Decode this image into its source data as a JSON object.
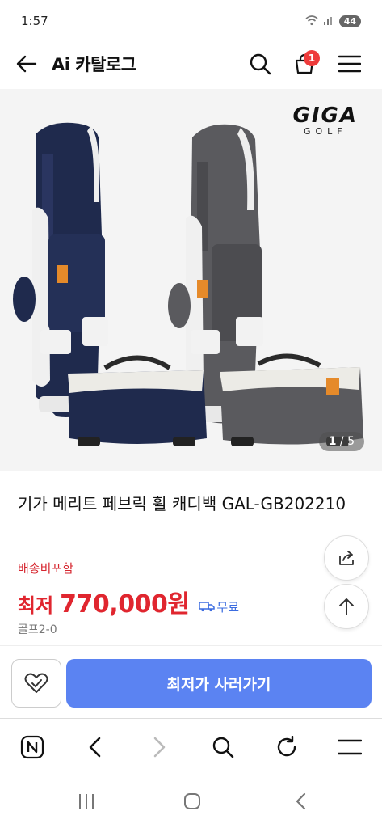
{
  "status_bar": {
    "time": "1:57",
    "battery": "44"
  },
  "header": {
    "title": "Ai 카탈로그",
    "cart_count": "1"
  },
  "product_image": {
    "brand_name": "GIGA",
    "brand_sub": "GOLF",
    "current_index": "1",
    "total": "/ 5"
  },
  "product": {
    "title": "기가 메리트 페브릭 휠 캐디백 GAL-GB202210",
    "shipping_note": "배송비포함",
    "price_label": "최저",
    "price": "770,000원",
    "free_shipping": "무료",
    "seller": "골프2-0"
  },
  "actions": {
    "buy_label": "최저가 사러가기"
  },
  "colors": {
    "accent": "#5b83f2",
    "price": "#e0262f",
    "badge": "#ee3b3b",
    "navy": "#1f2a4d",
    "gray": "#5a5a5e"
  }
}
